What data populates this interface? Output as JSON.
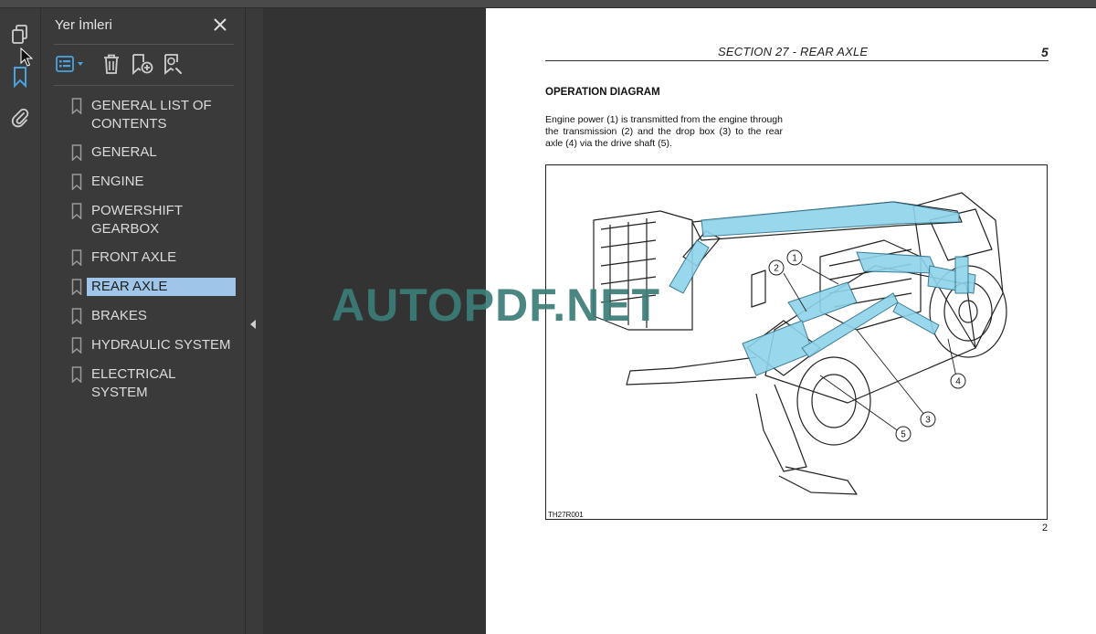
{
  "panel": {
    "title": "Yer İmleri",
    "bookmarks": [
      {
        "label": "GENERAL LIST OF CONTENTS"
      },
      {
        "label": "GENERAL"
      },
      {
        "label": "ENGINE"
      },
      {
        "label": "POWERSHIFT GEARBOX"
      },
      {
        "label": "FRONT AXLE"
      },
      {
        "label": "REAR AXLE",
        "selected": true
      },
      {
        "label": "BRAKES"
      },
      {
        "label": "HYDRAULIC SYSTEM"
      },
      {
        "label": "ELECTRICAL SYSTEM"
      }
    ]
  },
  "rail": {
    "icons": [
      "pages-icon",
      "bookmark-icon",
      "attachment-icon"
    ],
    "active": "bookmark-icon"
  },
  "toolbar": {
    "icons": [
      "options-icon",
      "delete-bookmark-icon",
      "add-bookmark-icon",
      "find-bookmark-icon"
    ]
  },
  "document": {
    "header_section": "SECTION 27 - REAR AXLE",
    "header_page": "5",
    "heading": "OPERATION DIAGRAM",
    "body": "Engine power (1) is transmitted from the engine through the transmission (2) and the drop box (3) to the rear axle (4) via the drive shaft (5).",
    "figure_code": "TH27R001",
    "figure_callouts": [
      "1",
      "2",
      "3",
      "4",
      "5"
    ],
    "page_number": "2"
  },
  "watermark": "AUTOPDF.NET",
  "colors": {
    "selected_bookmark_bg": "#9fc5e8",
    "accent_blue": "#4aa3df",
    "highlight_cyan": "#8fd3ea",
    "watermark": "#3b7d78"
  }
}
